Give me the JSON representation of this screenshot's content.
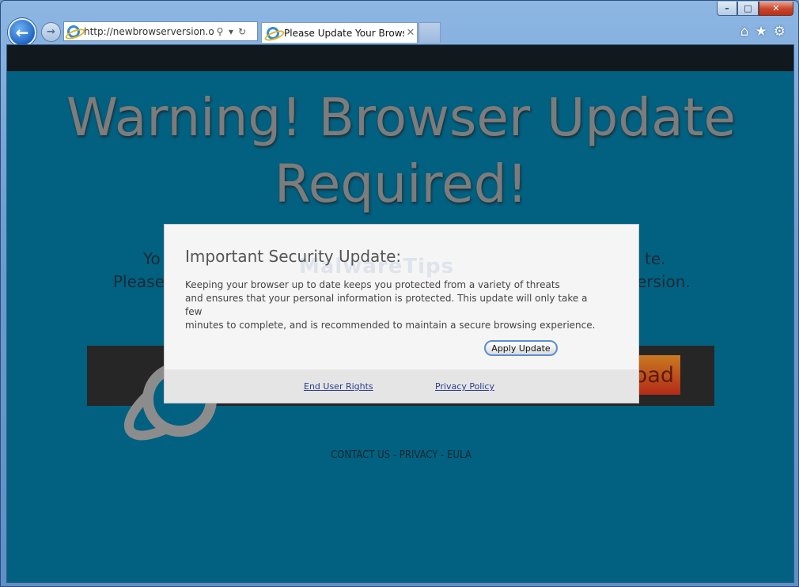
{
  "browser": {
    "url": "http://newbrowserversion.org/i",
    "tab_title": "Please Update Your Browse...",
    "window_controls": {
      "minimize": "–",
      "maximize": "□",
      "close": "✕"
    },
    "icons": [
      "home-icon",
      "favorites-star-icon",
      "gear-icon"
    ]
  },
  "page": {
    "headline_line1": "Warning! Browser Update",
    "headline_line2": "Required!",
    "bg_line1_left": "Yo",
    "bg_line1_right": "te.",
    "bg_line2_left": "Please",
    "bg_line2_right": "ersion.",
    "download_partial": "oad",
    "footer": "CONTACT US - PRIVACY - EULA"
  },
  "modal": {
    "title": "Important Security Update:",
    "watermark": "MalwareTips",
    "body_lines": [
      "Keeping your browser up to date keeps you protected from a variety of threats",
      "and ensures that your personal information is protected.  This update will only take a few",
      "minutes to complete, and is recommended to maintain a secure browsing experience."
    ],
    "apply_button": "Apply Update",
    "link_end_user_rights": "End User Rights",
    "link_privacy_policy": "Privacy Policy"
  },
  "colors": {
    "page_background": "#026180",
    "headline": "#7c7c7c",
    "download_button": "#c0461c",
    "modal_background": "#f5f5f5"
  }
}
